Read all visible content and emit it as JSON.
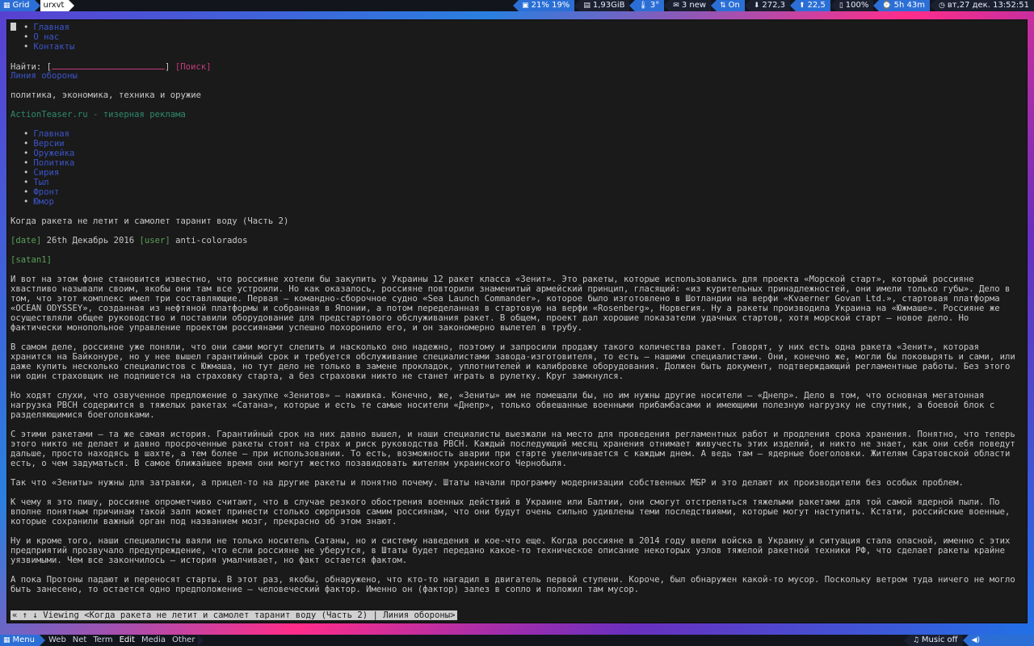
{
  "topbar": {
    "layout_label": "Grid",
    "window_title": "urxvt",
    "indicators": [
      {
        "icon": "cpu-icon",
        "text": "21% 19%"
      },
      {
        "icon": "memory-icon",
        "text": "1,93GiB"
      },
      {
        "icon": "temperature-icon",
        "text": "3°"
      },
      {
        "icon": "mail-icon",
        "text": "3 new"
      },
      {
        "icon": "network-icon",
        "text": "On"
      },
      {
        "icon": "download-icon",
        "text": "272,3"
      },
      {
        "icon": "upload-icon",
        "text": "22,5"
      },
      {
        "icon": "battery-icon",
        "text": "100%"
      },
      {
        "icon": "uptime-icon",
        "text": "5h 43m"
      },
      {
        "icon": "clock-icon",
        "text": "вт,27 дек. 13:52:51"
      }
    ]
  },
  "page": {
    "nav_top": [
      "Главная",
      "О нас",
      "Контакты"
    ],
    "search_label": "Найти: [",
    "search_close": "]",
    "search_button": "[Поиск]",
    "site_title": "Линия обороны",
    "site_subtitle": "политика, экономика, техника и оружие",
    "ad_link": "ActionTeaser.ru - тизерная реклама",
    "nav_main": [
      "Главная",
      "Версии",
      "Оружейка",
      "Политика",
      "Сирия",
      "Тыл",
      "Фронт",
      "Юмор"
    ],
    "article_title": "Когда ракета не летит и самолет таранит воду (Часть 2)",
    "date_tag": "[date]",
    "date_value": "26th Декабрь 2016",
    "user_tag": "[user]",
    "user_value": "anti-colorados",
    "avatar_tag": "[satan1]",
    "paragraphs": [
      "И вот на этом фоне становится известно, что россияне хотели бы закупить у Украины 12 ракет класса «Зенит». Это ракеты, которые использовались для проекта «Морской старт», который россияне хвастливо называли своим, якобы они там все устроили. Но как оказалось, россияне повторили знаменитый армейский принцип, гласящий: «из курительных принадлежностей, они имели только губы». Дело в том, что этот комплекс имел три составляющие. Первая – командно-сборочное судно «Sea Launch Commander», которое было изготовлено в Шотландии на верфи «Kvaerner Govan Ltd.», стартовая платформа «OCEAN ODYSSEY», созданная из нефтяной платформы и собранная в Японии, а потом переделанная в стартовую на верфи «Rosenberg», Норвегия. Ну а ракеты производила Украина на «Южмаше». Россияне же осуществляли общее руководство и поставили оборудование для предстартового обслуживания ракет. В общем, проект дал хорошие показатели удачных стартов, хотя морской старт – новое дело. Но фактически монопольное управление проектом россиянами успешно похоронило его, и он закономерно вылетел в трубу.",
      "В самом деле, россияне уже поняли, что они сами могут слепить и насколько оно надежно, поэтому и запросили продажу такого количества ракет. Говорят, у них есть одна ракета «Зенит», которая хранится на Байконуре, но у нее вышел гарантийный срок и требуется обслуживание специалистами завода-изготовителя, то есть – нашими специалистами. Они, конечно же, могли бы поковырять и сами, или даже купить несколько специалистов с Южмаша, но тут дело не только в замене прокладок, уплотнителей и калибровке оборудования. Должен быть документ, подтверждающий регламентные работы. Без этого ни один страховщик не подпишется на страховку старта, а без страховки никто не станет играть в рулетку. Круг замкнулся.",
      "Но ходят слухи, что озвученное предложение о закупке «Зенитов» – наживка. Конечно, же, «Зениты» им не помешали бы, но им нужны другие носители – «Днепр». Дело в том, что основная мегатонная нагрузка РВСН содержится в тяжелых ракетах «Сатана», которые и есть те самые носители «Днепр», только обвешанные военными прибамбасами и имеющими полезную нагрузку не спутник, а боевой блок с разделяющимися боеголовками.",
      "С этими ракетами – та же самая история. Гарантийный срок на них давно вышел, и наши специалисты выезжали на место для проведения регламентных работ и продления срока хранения. Понятно, что теперь этого никто не делает и давно просроченные ракеты стоят на страх и риск руководства РВСН. Каждый последующий месяц хранения отнимает живучесть этих изделий, и никто не знает, как они себя поведут дальше, просто находясь в шахте, а тем более – при использовании. То есть, возможность аварии при старте увеличивается с каждым днем. А ведь там – ядерные боеголовки. Жителям Саратовской области есть, о чем задуматься. В самое ближайшее время они могут жестко позавидовать жителям украинского Чернобыля.",
      "Так что «Зениты» нужны для затравки, а прицел-то на другие ракеты и понятно почему. Штаты начали программу модернизации собственных МБР и это делают их производители без особых проблем.",
      "К чему я это пишу, россияне опрометчиво считают, что в случае резкого обострения военных действий в Украине или Балтии, они смогут отстреляться тяжелыми ракетами для той самой ядерной пыли. По вполне понятным причинам такой залп может принести столько сюрпризов самим россиянам, что они будут очень сильно удивлены теми последствиями, которые могут наступить. Кстати, российские военные, которые сохранили важный орган под названием мозг, прекрасно об этом знают.",
      "Ну и кроме того, наши специалисты ваяли не только носитель Сатаны, но и систему наведения и кое-что еще. Когда россияне в 2014 году ввели войска в Украину и ситуация стала опасной, именно с этих предприятий прозвучало предупреждение, что если россияне не уберутся, в Штаты будет передано какое-то техническое описание некоторых узлов тяжелой ракетной техники РФ, что сделает ракеты крайне уязвимыми. Чем все закончилось – история умалчивает, но факт остается фактом.",
      "А пока Протоны падают и переносят старты. В этот раз, якобы, обнаружено, что кто-то нагадил в двигатель первой ступени. Короче, был обнаружен какой-то мусор. Поскольку ветром туда ничего не могло быть занесено, то остается одно предположение – человеческий фактор. Именно он (фактор) залез в сопло и положил там мусор."
    ],
    "status_line": "« ↑ ↓ Viewing <Когда ракета не летит и самолет таранит воду (Часть 2) | Линия обороны>"
  },
  "botbar": {
    "menu_label": "Menu",
    "items": [
      "Web",
      "Net",
      "Term",
      "Edit",
      "Media",
      "Other"
    ],
    "music_label": "Music off"
  }
}
